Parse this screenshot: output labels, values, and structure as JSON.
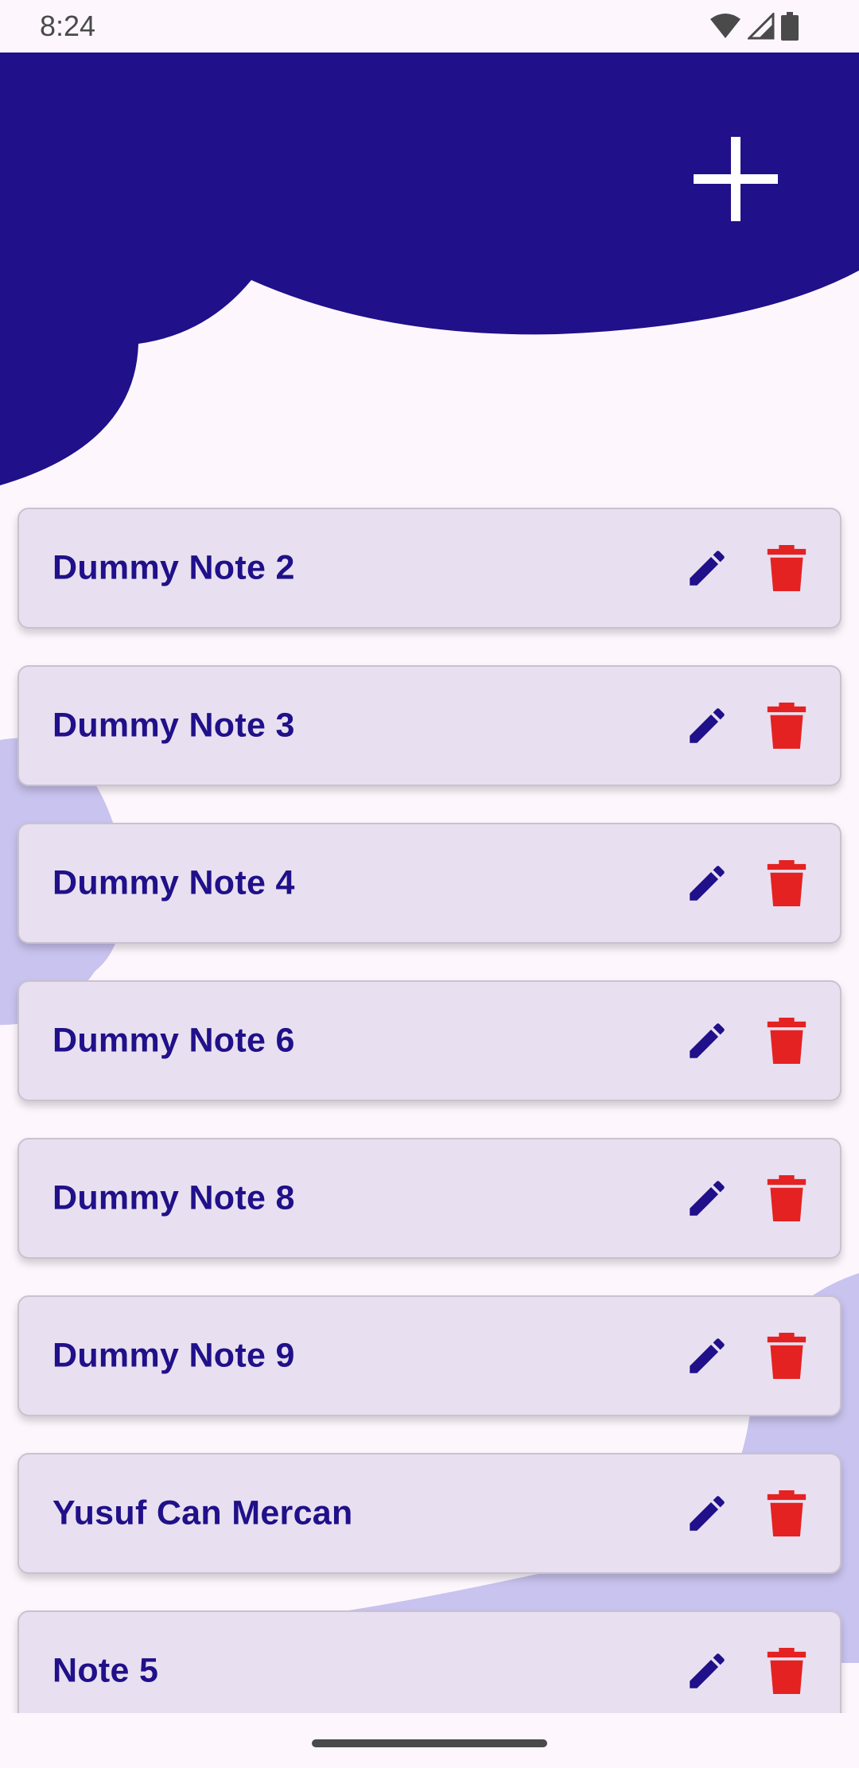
{
  "status_bar": {
    "time": "8:24",
    "icons": [
      "wifi-icon",
      "signal-icon",
      "battery-icon"
    ]
  },
  "header": {
    "add_icon": "plus-icon"
  },
  "notes": [
    {
      "title": "Dummy Note 2"
    },
    {
      "title": "Dummy Note 3"
    },
    {
      "title": "Dummy Note 4"
    },
    {
      "title": "Dummy Note 6"
    },
    {
      "title": "Dummy Note 8"
    },
    {
      "title": "Dummy Note 9"
    },
    {
      "title": "Yusuf Can Mercan"
    },
    {
      "title": "Note 5"
    }
  ],
  "icons": {
    "edit": "pencil-icon",
    "delete": "trash-icon"
  },
  "colors": {
    "primary": "#201089",
    "background": "#fdf7fd",
    "card": "#e8e0f0",
    "delete": "#e42222",
    "blob_light": "#c9c3ef"
  }
}
